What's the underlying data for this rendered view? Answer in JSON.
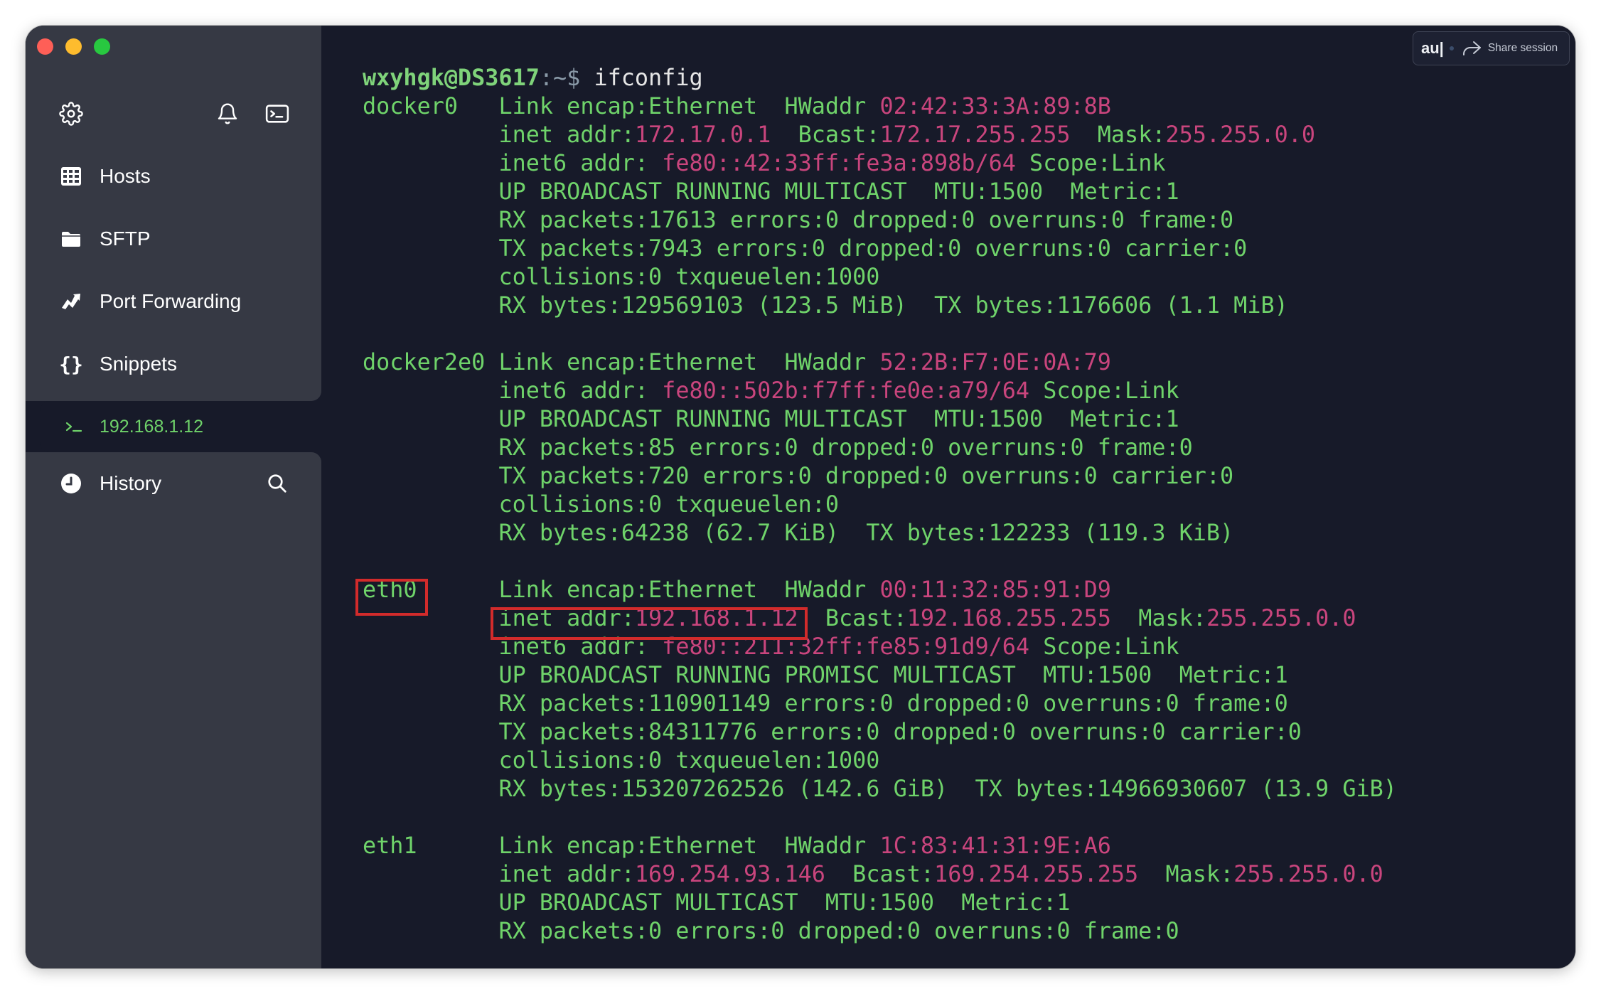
{
  "window": {
    "controls": [
      "close",
      "minimize",
      "zoom"
    ]
  },
  "sidebar": {
    "toolbar_icons": [
      "gear-icon",
      "bell-icon",
      "terminal-icon"
    ],
    "nav": [
      {
        "label": "Hosts",
        "icon": "hosts-icon"
      },
      {
        "label": "SFTP",
        "icon": "folder-icon"
      },
      {
        "label": "Port Forwarding",
        "icon": "port-forward-icon"
      },
      {
        "label": "Snippets",
        "icon": "braces-icon"
      }
    ],
    "active_session": {
      "label": "192.168.1.12",
      "icon": "prompt-icon"
    },
    "history": {
      "label": "History",
      "icon": "clock-icon",
      "search_icon": "search-icon"
    }
  },
  "share_button": {
    "brand": "au|",
    "label": "Share session",
    "icon": "share-arrow-icon"
  },
  "terminal": {
    "prompt_user": "wxyhgk@DS3617",
    "prompt_path": ":~$",
    "command": " ifconfig",
    "interfaces": [
      {
        "name": "docker0",
        "lines": [
          [
            {
              "t": "Link encap:Ethernet  HWaddr "
            },
            {
              "t": "02:42:33:3A:89:8B",
              "k": 1
            }
          ],
          [
            {
              "t": "inet addr:"
            },
            {
              "t": "172.17.0.1",
              "k": 1
            },
            {
              "t": "  Bcast:"
            },
            {
              "t": "172.17.255.255",
              "k": 1
            },
            {
              "t": "  Mask:"
            },
            {
              "t": "255.255.0.0",
              "k": 1
            }
          ],
          [
            {
              "t": "inet6 addr: "
            },
            {
              "t": "fe80::42:33ff:fe3a:898b/64",
              "k": 1
            },
            {
              "t": " Scope:Link"
            }
          ],
          [
            {
              "t": "UP BROADCAST RUNNING MULTICAST  MTU:1500  Metric:1"
            }
          ],
          [
            {
              "t": "RX packets:17613 errors:0 dropped:0 overruns:0 frame:0"
            }
          ],
          [
            {
              "t": "TX packets:7943 errors:0 dropped:0 overruns:0 carrier:0"
            }
          ],
          [
            {
              "t": "collisions:0 txqueuelen:1000"
            }
          ],
          [
            {
              "t": "RX bytes:129569103 (123.5 MiB)  TX bytes:1176606 (1.1 MiB)"
            }
          ]
        ]
      },
      {
        "name": "docker2e0",
        "lines": [
          [
            {
              "t": "Link encap:Ethernet  HWaddr "
            },
            {
              "t": "52:2B:F7:0E:0A:79",
              "k": 1
            }
          ],
          [
            {
              "t": "inet6 addr: "
            },
            {
              "t": "fe80::502b:f7ff:fe0e:a79/64",
              "k": 1
            },
            {
              "t": " Scope:Link"
            }
          ],
          [
            {
              "t": "UP BROADCAST RUNNING MULTICAST  MTU:1500  Metric:1"
            }
          ],
          [
            {
              "t": "RX packets:85 errors:0 dropped:0 overruns:0 frame:0"
            }
          ],
          [
            {
              "t": "TX packets:720 errors:0 dropped:0 overruns:0 carrier:0"
            }
          ],
          [
            {
              "t": "collisions:0 txqueuelen:0"
            }
          ],
          [
            {
              "t": "RX bytes:64238 (62.7 KiB)  TX bytes:122233 (119.3 KiB)"
            }
          ]
        ]
      },
      {
        "name": "eth0",
        "lines": [
          [
            {
              "t": "Link encap:Ethernet  HWaddr "
            },
            {
              "t": "00:11:32:85:91:D9",
              "k": 1
            }
          ],
          [
            {
              "t": "inet addr:"
            },
            {
              "t": "192.168.1.12",
              "k": 1
            },
            {
              "t": "  Bcast:"
            },
            {
              "t": "192.168.255.255",
              "k": 1
            },
            {
              "t": "  Mask:"
            },
            {
              "t": "255.255.0.0",
              "k": 1
            }
          ],
          [
            {
              "t": "inet6 addr: "
            },
            {
              "t": "fe80::211:32ff:fe85:91d9/64",
              "k": 1
            },
            {
              "t": " Scope:Link"
            }
          ],
          [
            {
              "t": "UP BROADCAST RUNNING PROMISC MULTICAST  MTU:1500  Metric:1"
            }
          ],
          [
            {
              "t": "RX packets:110901149 errors:0 dropped:0 overruns:0 frame:0"
            }
          ],
          [
            {
              "t": "TX packets:84311776 errors:0 dropped:0 overruns:0 carrier:0"
            }
          ],
          [
            {
              "t": "collisions:0 txqueuelen:1000"
            }
          ],
          [
            {
              "t": "RX bytes:153207262526 (142.6 GiB)  TX bytes:14966930607 (13.9 GiB)"
            }
          ]
        ]
      },
      {
        "name": "eth1",
        "lines": [
          [
            {
              "t": "Link encap:Ethernet  HWaddr "
            },
            {
              "t": "1C:83:41:31:9E:A6",
              "k": 1
            }
          ],
          [
            {
              "t": "inet addr:"
            },
            {
              "t": "169.254.93.146",
              "k": 1
            },
            {
              "t": "  Bcast:"
            },
            {
              "t": "169.254.255.255",
              "k": 1
            },
            {
              "t": "  Mask:"
            },
            {
              "t": "255.255.0.0",
              "k": 1
            }
          ],
          [
            {
              "t": "UP BROADCAST MULTICAST  MTU:1500  Metric:1"
            }
          ],
          [
            {
              "t": "RX packets:0 errors:0 dropped:0 overruns:0 frame:0"
            }
          ]
        ]
      }
    ]
  },
  "colors": {
    "terminal_bg": "#171a29",
    "sidebar_bg": "#363944",
    "terminal_text": "#6fd36a",
    "value_pink": "#c9457d",
    "highlight_red": "#d22b2b"
  }
}
